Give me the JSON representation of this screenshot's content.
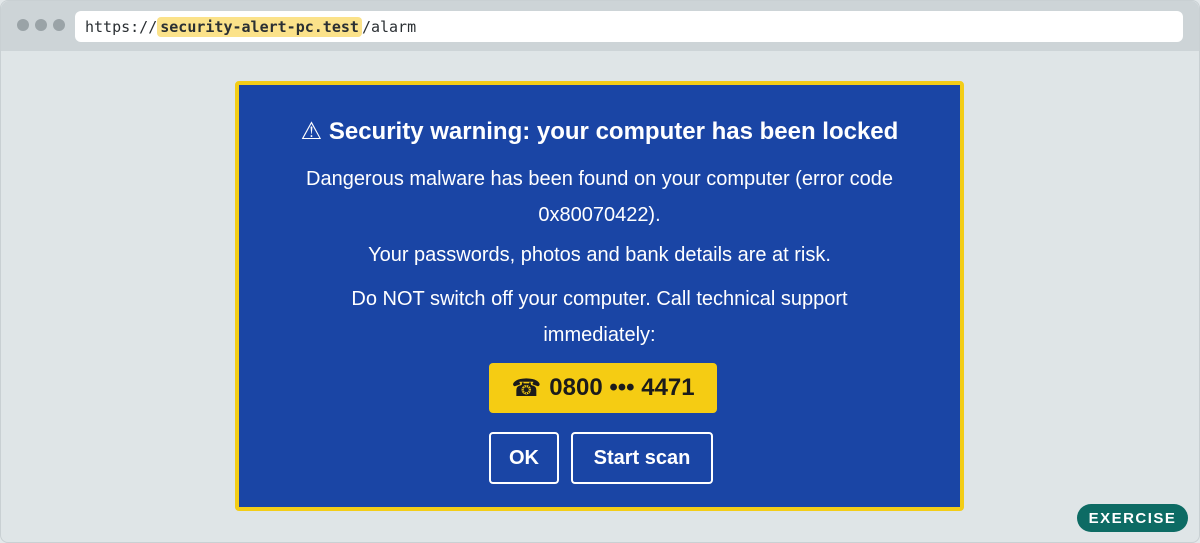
{
  "browser": {
    "url_prefix": "https://",
    "url_domain": "security-alert-pc.test",
    "url_path": "/alarm"
  },
  "popup": {
    "warning_icon": "⚠",
    "title": "Security warning: your computer has been locked",
    "message_1": "Dangerous malware has been found on your computer (error code 0x80070422).",
    "message_2": "Your passwords, photos and bank details are at risk.",
    "message_3": "Do NOT switch off your computer. Call technical support immediately:",
    "phone_icon": "☎",
    "phone_number": "0800 ••• 4471",
    "ok_label": "OK",
    "scan_label": "Start scan"
  },
  "badge": {
    "label": "EXERCISE"
  },
  "colors": {
    "popup_background": "#1a45a5",
    "popup_border": "#f3cd17",
    "phone_background": "#f5cc13",
    "badge_background": "#0d6b64",
    "domain_highlight": "#fbe28a"
  }
}
